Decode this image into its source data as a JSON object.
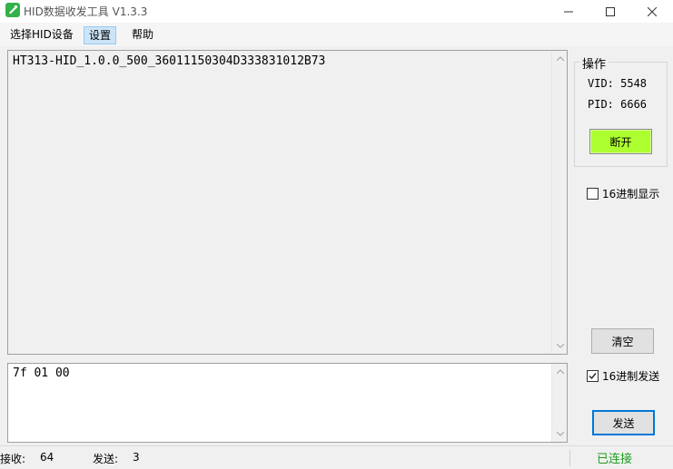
{
  "window": {
    "title": "HID数据收发工具 V1.3.3"
  },
  "menu": {
    "items": [
      {
        "label": "选择HID设备"
      },
      {
        "label": "设置"
      },
      {
        "label": "帮助"
      }
    ]
  },
  "receive": {
    "text": "HT313-HID_1.0.0_500_36011150304D333831012B73"
  },
  "send": {
    "text": "7f 01 00"
  },
  "operation": {
    "title": "操作",
    "vid": "VID: 5548",
    "pid": "PID: 6666",
    "disconnect_label": "断开",
    "disconnect_color": "#adff2f"
  },
  "options": {
    "hex_display_label": "16进制显示",
    "hex_display_checked": false,
    "hex_send_label": "16进制发送",
    "hex_send_checked": true
  },
  "buttons": {
    "clear_label": "清空",
    "send_label": "发送"
  },
  "status": {
    "recv_label": "接收:",
    "recv_count": "64",
    "send_label": "发送:",
    "send_count": "3",
    "connection": "已连接",
    "connection_color": "#1e9e1e"
  }
}
